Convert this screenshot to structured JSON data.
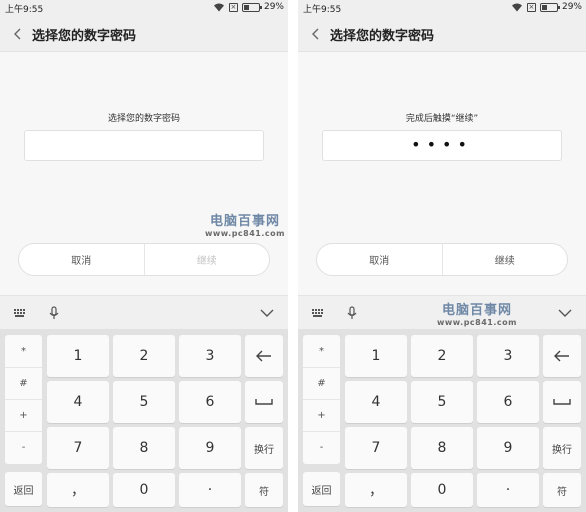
{
  "status_bar": {
    "time": "上午9:55",
    "sim_label": "×",
    "battery": "29%"
  },
  "screens": {
    "left": {
      "title": "选择您的数字密码",
      "prompt": "选择您的数字密码",
      "pin_value": "",
      "cancel_label": "取消",
      "continue_label": "继续",
      "continue_enabled": false
    },
    "right": {
      "title": "选择您的数字密码",
      "prompt": "完成后触摸“继续”",
      "pin_value": "••••",
      "cancel_label": "取消",
      "continue_label": "继续",
      "continue_enabled": true
    }
  },
  "keyboard": {
    "symbols": [
      "*",
      "#",
      "+",
      "-"
    ],
    "back_label": "返回",
    "digits": [
      "1",
      "2",
      "3",
      "4",
      "5",
      "6",
      "7",
      "8",
      "9",
      "0"
    ],
    "comma": "，",
    "dot": "·",
    "newline_label": "换行",
    "symbol_label": "符",
    "toolbar_icons": [
      "grid-icon",
      "microphone-icon",
      "chevron-down-icon"
    ],
    "side_icons": [
      "backspace-icon",
      "space-icon"
    ]
  },
  "watermark": {
    "title": "电脑百事网",
    "url": "www.pc841.com"
  }
}
